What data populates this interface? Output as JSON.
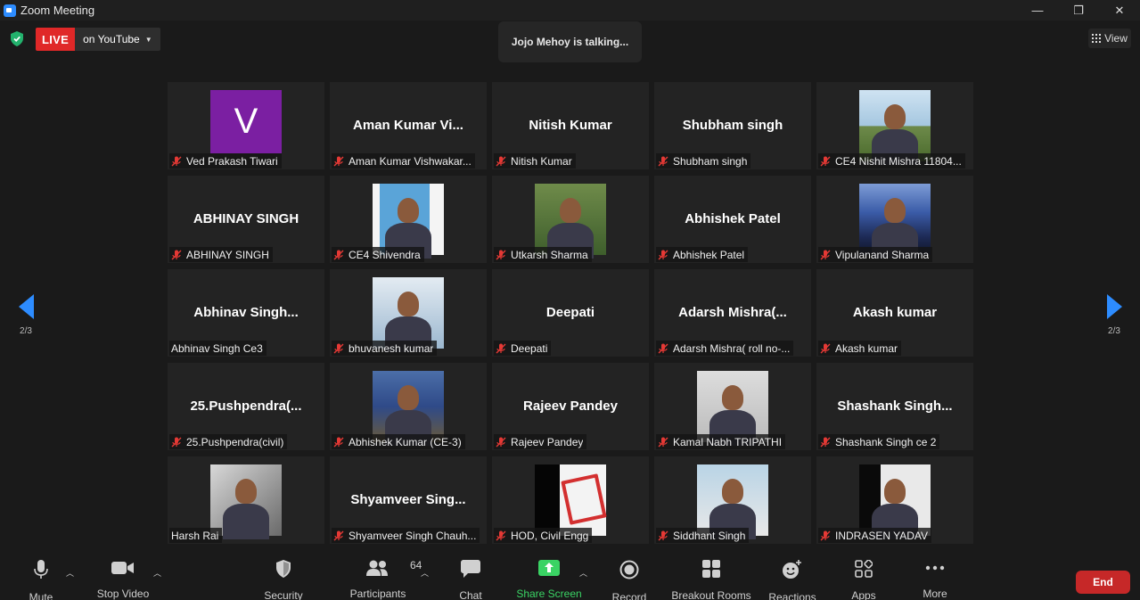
{
  "window": {
    "title": "Zoom Meeting",
    "controls": [
      "—",
      "❐",
      "✕"
    ]
  },
  "topbar": {
    "live_label": "LIVE",
    "stream_target": "on YouTube",
    "talking": "Jojo Mehoy is talking...",
    "view_label": "View"
  },
  "paging": {
    "left_page": "2/3",
    "right_page": "2/3"
  },
  "tiles": [
    {
      "big": "",
      "label": "Ved Prakash Tiwari",
      "muted": true,
      "avatar_letter": "V",
      "photo": ""
    },
    {
      "big": "Aman Kumar Vi...",
      "label": "Aman Kumar Vishwakar...",
      "muted": true,
      "avatar_letter": "",
      "photo": ""
    },
    {
      "big": "Nitish Kumar",
      "label": "Nitish Kumar",
      "muted": true,
      "avatar_letter": "",
      "photo": ""
    },
    {
      "big": "Shubham singh",
      "label": "Shubham singh",
      "muted": true,
      "avatar_letter": "",
      "photo": ""
    },
    {
      "big": "",
      "label": "CE4 Nishit Mishra 11804...",
      "muted": true,
      "avatar_letter": "",
      "photo": "ph-sky"
    },
    {
      "big": "ABHINAY SINGH",
      "label": "ABHINAY SINGH",
      "muted": true,
      "avatar_letter": "",
      "photo": ""
    },
    {
      "big": "",
      "label": "CE4 Shivendra",
      "muted": true,
      "avatar_letter": "",
      "photo": "ph-sea"
    },
    {
      "big": "",
      "label": "Utkarsh Sharma",
      "muted": true,
      "avatar_letter": "",
      "photo": "ph-green"
    },
    {
      "big": "Abhishek Patel",
      "label": "Abhishek Patel",
      "muted": true,
      "avatar_letter": "",
      "photo": ""
    },
    {
      "big": "",
      "label": "Vipulanand Sharma",
      "muted": true,
      "avatar_letter": "",
      "photo": "ph-night"
    },
    {
      "big": "Abhinav  Singh...",
      "label": "Abhinav Singh Ce3",
      "muted": false,
      "avatar_letter": "",
      "photo": ""
    },
    {
      "big": "",
      "label": "bhuvanesh kumar",
      "muted": true,
      "avatar_letter": "",
      "photo": "ph-blue"
    },
    {
      "big": "Deepati",
      "label": "Deepati",
      "muted": true,
      "avatar_letter": "",
      "photo": ""
    },
    {
      "big": "Adarsh  Mishra(...",
      "label": "Adarsh Mishra( roll no-...",
      "muted": true,
      "avatar_letter": "",
      "photo": ""
    },
    {
      "big": "Akash kumar",
      "label": "Akash kumar",
      "muted": true,
      "avatar_letter": "",
      "photo": ""
    },
    {
      "big": "25.Pushpendra(...",
      "label": "25.Pushpendra(civil)",
      "muted": true,
      "avatar_letter": "",
      "photo": ""
    },
    {
      "big": "",
      "label": "Abhishek Kumar (CE-3)",
      "muted": true,
      "avatar_letter": "",
      "photo": "ph-outdoor"
    },
    {
      "big": "Rajeev Pandey",
      "label": "Rajeev Pandey",
      "muted": true,
      "avatar_letter": "",
      "photo": ""
    },
    {
      "big": "",
      "label": "Kamal Nabh TRIPATHI",
      "muted": true,
      "avatar_letter": "",
      "photo": "ph-office"
    },
    {
      "big": "Shashank  Singh...",
      "label": "Shashank Singh ce 2",
      "muted": true,
      "avatar_letter": "",
      "photo": ""
    },
    {
      "big": "",
      "label": "Harsh Rai",
      "muted": false,
      "avatar_letter": "",
      "photo": "ph-bw"
    },
    {
      "big": "Shyamveer  Sing...",
      "label": "Shyamveer Singh Chauh...",
      "muted": true,
      "avatar_letter": "",
      "photo": ""
    },
    {
      "big": "",
      "label": "HOD, Civil Engg",
      "muted": true,
      "avatar_letter": "",
      "photo": "ph-hod"
    },
    {
      "big": "",
      "label": "Siddhant Singh",
      "muted": true,
      "avatar_letter": "",
      "photo": "ph-selfie"
    },
    {
      "big": "",
      "label": "INDRASEN YADAV",
      "muted": true,
      "avatar_letter": "",
      "photo": "ph-indra"
    }
  ],
  "toolbar": {
    "mute": "Mute",
    "stop_video": "Stop Video",
    "security": "Security",
    "participants": "Participants",
    "participants_count": "64",
    "chat": "Chat",
    "share_screen": "Share Screen",
    "record": "Record",
    "breakout_rooms": "Breakout Rooms",
    "reactions": "Reactions",
    "apps": "Apps",
    "more": "More",
    "end": "End"
  },
  "colors": {
    "accent_blue": "#2d8cff",
    "live_red": "#e02828",
    "end_red": "#c62828",
    "share_green": "#3ad364",
    "muted_red": "#e53935",
    "avatar_purple": "#7b1fa2"
  }
}
